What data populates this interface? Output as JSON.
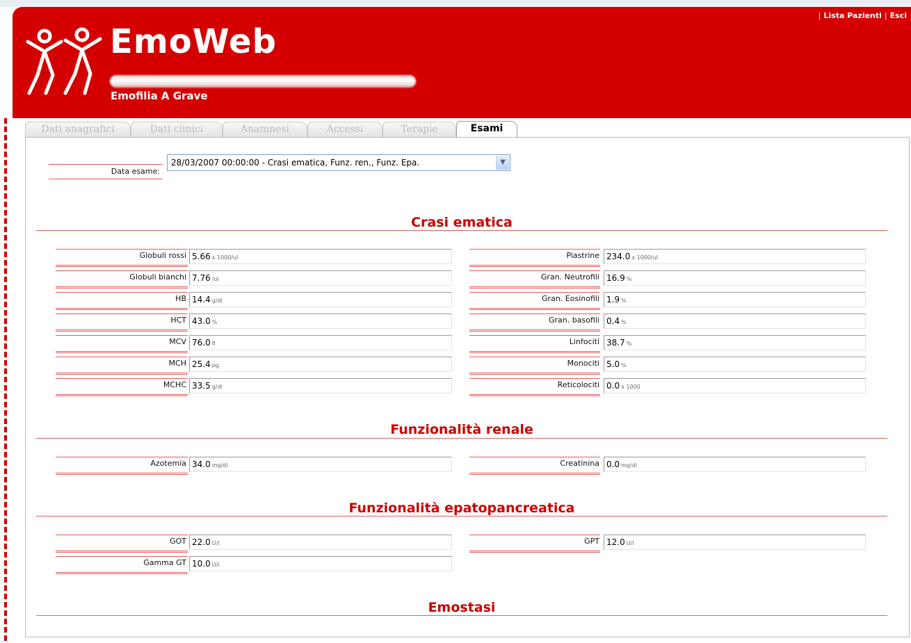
{
  "header": {
    "app_title": "EmoWeb",
    "diagnosis": "Emofilia A Grave",
    "links": [
      "Lista Pazienti",
      "Esci"
    ]
  },
  "tabs": [
    {
      "label": "Dati anagrafici",
      "active": false
    },
    {
      "label": "Dati clinici",
      "active": false
    },
    {
      "label": "Anamnesi",
      "active": false
    },
    {
      "label": "Accessi",
      "active": false
    },
    {
      "label": "Terapie",
      "active": false
    },
    {
      "label": "Esami",
      "active": true
    }
  ],
  "exam_date": {
    "label": "Data esame:",
    "selected": "28/03/2007 00:00:00 - Crasi ematica, Funz. ren., Funz. Epa."
  },
  "sections": {
    "crasi": {
      "title": "Crasi ematica",
      "left": [
        {
          "label": "Globuli rossi",
          "value": "5.66",
          "unit": "x 1000/ul"
        },
        {
          "label": "Globuli bianchi",
          "value": "7.76",
          "unit": "/ul"
        },
        {
          "label": "HB",
          "value": "14.4",
          "unit": "g/dl"
        },
        {
          "label": "HCT",
          "value": "43.0",
          "unit": "%"
        },
        {
          "label": "MCV",
          "value": "76.0",
          "unit": "fl"
        },
        {
          "label": "MCH",
          "value": "25.4",
          "unit": "pg"
        },
        {
          "label": "MCHC",
          "value": "33.5",
          "unit": "g/dl"
        }
      ],
      "right": [
        {
          "label": "Piastrine",
          "value": "234.0",
          "unit": "x 1000/ul"
        },
        {
          "label": "Gran. Neutrofili",
          "value": "16.9",
          "unit": "%"
        },
        {
          "label": "Gran. Eosinofili",
          "value": "1.9",
          "unit": "%"
        },
        {
          "label": "Gran. basofili",
          "value": "0.4",
          "unit": "%"
        },
        {
          "label": "Linfociti",
          "value": "38.7",
          "unit": "%"
        },
        {
          "label": "Monociti",
          "value": "5.0",
          "unit": "%"
        },
        {
          "label": "Reticolociti",
          "value": "0.0",
          "unit": "x 1000"
        }
      ]
    },
    "renale": {
      "title": "Funzionalità renale",
      "left": [
        {
          "label": "Azotemia",
          "value": "34.0",
          "unit": "mg/dl"
        }
      ],
      "right": [
        {
          "label": "Creatinina",
          "value": "0.0",
          "unit": "mg/dl"
        }
      ]
    },
    "epato": {
      "title": "Funzionalità epatopancreatica",
      "left": [
        {
          "label": "GOT",
          "value": "22.0",
          "unit": "U/l"
        },
        {
          "label": "Gamma GT",
          "value": "10.0",
          "unit": "U/l"
        }
      ],
      "right": [
        {
          "label": "GPT",
          "value": "12.0",
          "unit": "U/l"
        }
      ]
    },
    "emostasi": {
      "title": "Emostasi"
    }
  }
}
